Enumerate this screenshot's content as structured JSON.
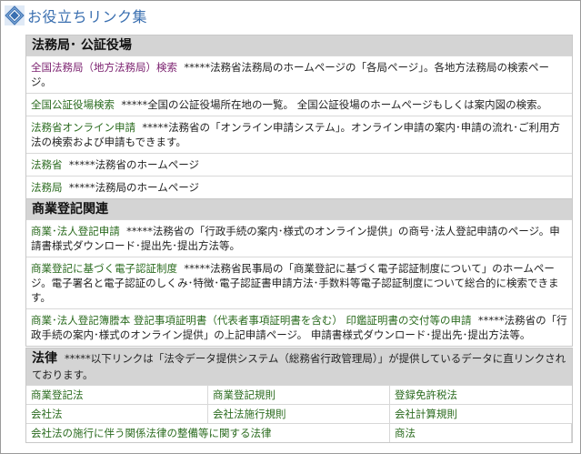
{
  "header": {
    "title": "お役立ちリンク集",
    "logo_icon": "diamond-logo-icon"
  },
  "sections": [
    {
      "title": "法務局･ 公証役場",
      "rows": [
        {
          "link": "全国法務局（地方法務局）検索",
          "desc": "*****法務省法務局のホームページの「各局ページ」。各地方法務局の検索ページ。",
          "visited": true
        },
        {
          "link": "全国公証役場検索",
          "desc": "*****全国の公証役場所在地の一覧。 全国公証役場のホームページもしくは案内図の検索。"
        },
        {
          "link": "法務省オンライン申請",
          "desc": "*****法務省の「オンライン申請システム」。オンライン申請の案内･申請の流れ･ご利用方法の検索および申請もできます。"
        },
        {
          "link": "法務省",
          "desc": "*****法務省のホームページ"
        },
        {
          "link": "法務局",
          "desc": "*****法務局のホームページ"
        }
      ]
    },
    {
      "title": "商業登記関連",
      "rows": [
        {
          "link": "商業･法人登記申請",
          "desc": "*****法務省の「行政手続の案内･様式のオンライン提供」の商号･法人登記申請のページ。申請書様式ダウンロード･提出先･提出方法等。"
        },
        {
          "link": "商業登記に基づく電子認証制度",
          "desc": "*****法務省民事局の「商業登記に基づく電子認証制度について」のホームページ。電子署名と電子認証のしくみ･特徴･電子認証書申請方法･手数料等電子認証制度について総合的に検索できます。"
        },
        {
          "link": "商業･法人登記簿謄本 登記事項証明書（代表者事項証明書を含む） 印鑑証明書の交付等の申請",
          "desc": "*****法務省の「行政手続の案内･様式のオンライン提供」の上記申請ページ。 申請書様式ダウンロード･提出先･提出方法等。"
        }
      ]
    }
  ],
  "law": {
    "title": "法律",
    "note": "*****以下リンクは「法令データ提供システム（総務省行政管理局）」が提供しているデータに直リンクされております。",
    "cells": [
      "商業登記法",
      "商業登記規則",
      "登録免許税法",
      "会社法",
      "会社法施行規則",
      "会社計算規則",
      "会社法の施行に伴う関係法律の整備等に関する法律",
      "商法"
    ]
  }
}
